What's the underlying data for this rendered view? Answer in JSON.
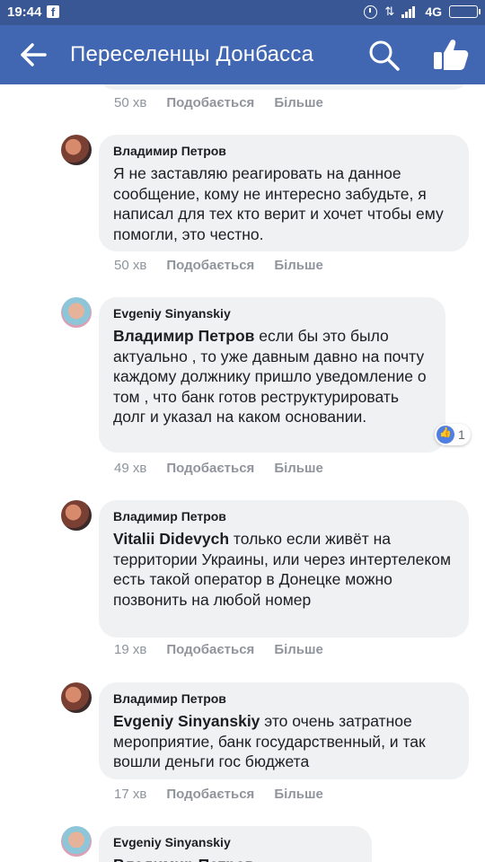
{
  "status_bar": {
    "time": "19:44",
    "network": "4G",
    "icons": [
      "facebook-icon",
      "alarm-icon",
      "data-icon",
      "signal-icon",
      "battery-icon"
    ]
  },
  "header": {
    "title": "Переселенцы Донбасса",
    "icons": [
      "back-arrow-icon",
      "search-icon",
      "like-icon"
    ]
  },
  "actions": {
    "like": "Подобається",
    "more": "Більше"
  },
  "colors": {
    "header": "#4267b2",
    "status_bar": "#3a5795",
    "bubble": "#f0f1f3"
  },
  "comments": [
    {
      "time": "50 хв"
    },
    {
      "author": "Владимир Петров",
      "text": "Я не заставляю реагировать на данное сообщение, кому не интересно забудьте, я написал для тех кто верит и хочет чтобы ему помогли, это честно.",
      "time": "50 хв"
    },
    {
      "author": "Evgeniy Sinyanskiy",
      "mention": "Владимир Петров",
      "text": " если бы это было актуально , то уже давным давно на почту каждому должнику пришло уведомление о том , что банк готов реструктурировать долг и указал на каком основании.",
      "time": "49 хв",
      "reactions": "1"
    },
    {
      "author": "Владимир Петров",
      "mention": "Vitalii Didevych",
      "text": " только если живёт на территории Украины, или через интертелеком есть такой оператор в Донецке можно позвонить на любой номер",
      "time": "19 хв"
    },
    {
      "author": "Владимир Петров",
      "mention": "Evgeniy Sinyanskiy",
      "text": " это очень затратное мероприятие, банк государственный, и так вошли деньги гос бюджета",
      "time": "17 хв"
    },
    {
      "author": "Evgeniy Sinyanskiy",
      "partial_text": "Владимир Петров"
    }
  ]
}
